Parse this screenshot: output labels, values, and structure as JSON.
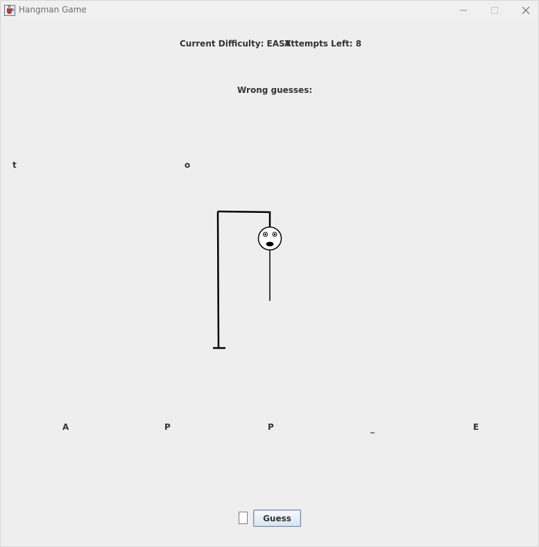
{
  "window": {
    "title": "Hangman Game"
  },
  "status": {
    "difficulty_label": "Current Difficulty: EASY",
    "attempts_label": "Attempts Left: 8"
  },
  "wrong_guesses": {
    "label": "Wrong guesses:",
    "letters": [
      "t",
      "o"
    ]
  },
  "word": {
    "letters": [
      "A",
      "P",
      "P",
      "_",
      "E"
    ]
  },
  "guess": {
    "input_value": "",
    "button_label": "Guess"
  },
  "icons": {
    "app": "java-cup-icon",
    "minimize": "minimize-icon",
    "maximize": "maximize-icon",
    "close": "close-icon"
  }
}
